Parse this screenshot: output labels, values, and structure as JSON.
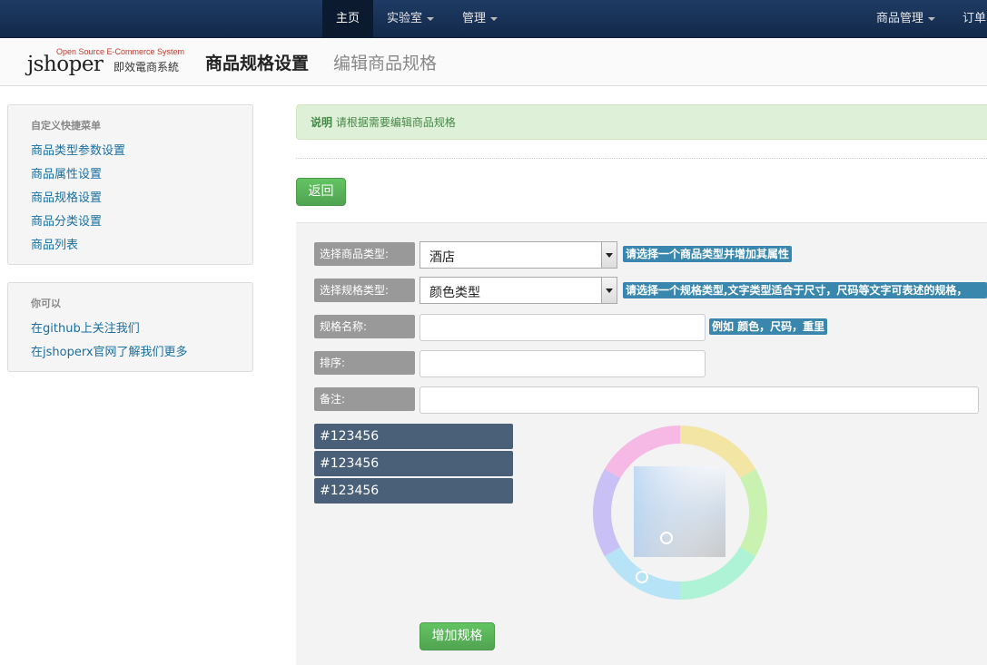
{
  "topnav": {
    "home": "主页",
    "lab": "实验室",
    "manage": "管理",
    "product_manage": "商品管理",
    "orders": "订单"
  },
  "header": {
    "logo_text": "jshoper",
    "logo_tagline": "Open Source E-Commerce System",
    "logo_cn": "即效電商系統",
    "title": "商品规格设置",
    "subtitle": "编辑商品规格"
  },
  "sidebar": {
    "shortcut_title": "自定义快捷菜单",
    "shortcuts": [
      "商品类型参数设置",
      "商品属性设置",
      "商品规格设置",
      "商品分类设置",
      "商品列表"
    ],
    "extra_title": "你可以",
    "extra_links": [
      "在github上关注我们",
      "在jshoperx官网了解我们更多"
    ]
  },
  "alert": {
    "strong": "说明",
    "text": "请根据需要编辑商品规格"
  },
  "back_button": "返回",
  "form": {
    "goods_type_label": "选择商品类型:",
    "goods_type_value": "酒店",
    "goods_type_help": "请选择一个商品类型并增加其属性",
    "spec_type_label": "选择规格类型:",
    "spec_type_value": "颜色类型",
    "spec_type_help": "请选择一个规格类型,文字类型适合于尺寸，尺码等文字可表述的规格，",
    "spec_name_label": "规格名称:",
    "spec_name_value": "",
    "spec_name_help": "例如 颜色，尺码，重里",
    "sort_label": "排序:",
    "sort_value": "",
    "note_label": "备注:",
    "note_value": ""
  },
  "color_values": [
    "#123456",
    "#123456",
    "#123456"
  ],
  "add_button": "增加规格",
  "colors": {
    "nav_bg": "#12294a",
    "green": "#51a351",
    "info": "#3a87ad",
    "swatch": "#4a6078"
  }
}
